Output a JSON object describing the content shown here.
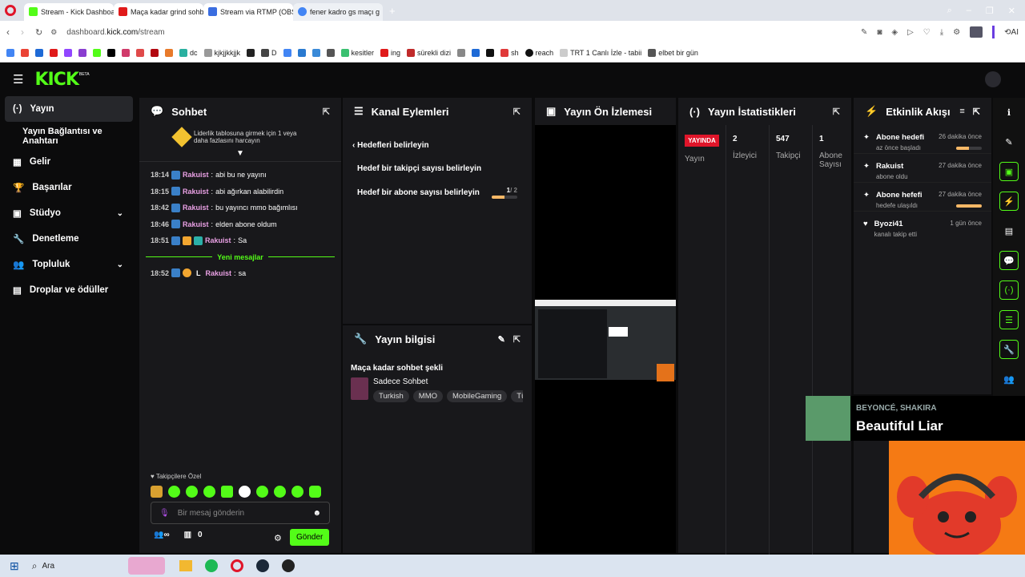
{
  "browser": {
    "tabs": [
      {
        "title": "Stream - Kick Dashboard",
        "color": "#53fc18",
        "active": true
      },
      {
        "title": "Maça kadar grind sohbet",
        "color": "#e01a1a",
        "active": true
      },
      {
        "title": "Stream via RTMP (OBS, Vm",
        "color": "#3a6de0",
        "active": true
      },
      {
        "title": "fener kadro gs maçı g",
        "color": "#4285f4",
        "active": false
      }
    ],
    "url_host": "dashboard.",
    "url_domain": "kick.com",
    "url_path": "/stream",
    "ai_label": "AI",
    "bookmarks": [
      "dc",
      "kjkjjkkjjk",
      "D",
      "kesitler",
      "ing",
      "sürekli dizi",
      "sh",
      "reach",
      "TRT 1 Canlı İzle - tabii",
      "elbet bir gün"
    ]
  },
  "brand": {
    "logo": "KICK",
    "beta": "BETA"
  },
  "sidebar": {
    "items": [
      {
        "label": "Yayın",
        "icon": "broadcast-icon",
        "glyph": "(·)",
        "active": true,
        "chevron": false
      },
      {
        "label": "Yayın Bağlantısı ve Anahtarı",
        "icon": "",
        "glyph": "",
        "active": false,
        "chevron": false
      },
      {
        "label": "Gelir",
        "icon": "revenue-icon",
        "glyph": "▦",
        "active": false,
        "chevron": false
      },
      {
        "label": "Başarılar",
        "icon": "trophy-icon",
        "glyph": "🏆",
        "active": false,
        "chevron": false
      },
      {
        "label": "Stüdyo",
        "icon": "studio-icon",
        "glyph": "▣",
        "active": false,
        "chevron": true
      },
      {
        "label": "Denetleme",
        "icon": "wrench-icon",
        "glyph": "🔧",
        "active": false,
        "chevron": false
      },
      {
        "label": "Topluluk",
        "icon": "community-icon",
        "glyph": "👥",
        "active": false,
        "chevron": true
      },
      {
        "label": "Droplar ve ödüller",
        "icon": "gift-icon",
        "glyph": "▤",
        "active": false,
        "chevron": false
      }
    ]
  },
  "chat": {
    "title": "Sohbet",
    "leaderboard": "Liderlik tablosuna girmek için 1 veya daha fazlasını harcayın",
    "messages": [
      {
        "time": "18:14",
        "user": "Rakuist",
        "text": "abi bu ne yayını"
      },
      {
        "time": "18:15",
        "user": "Rakuist",
        "text": "abi ağırkan alabilirdin"
      },
      {
        "time": "18:42",
        "user": "Rakuist",
        "text": "bu yayıncı mmo bağımlısı"
      },
      {
        "time": "18:46",
        "user": "Rakuist",
        "text": "elden abone oldum"
      },
      {
        "time": "18:51",
        "user": "Rakuist",
        "text": "Sa"
      }
    ],
    "new_messages": "Yeni mesajlar",
    "new_msg": {
      "time": "18:52",
      "prefix": "L",
      "user": "Rakuist",
      "text": "sa"
    },
    "followers_only": "Takipçilere Özel",
    "input_placeholder": "Bir mesaj gönderin",
    "points": "0",
    "send": "Gönder"
  },
  "actions": {
    "title": "Kanal Eylemleri",
    "back": "Hedefleri belirleyin",
    "goal1": "Hedef bir takipçi sayısı belirleyin",
    "goal2": "Hedef bir abone sayısı belirleyin",
    "goal2_progress": "1",
    "goal2_total": "/ 2",
    "goal2_fraction": 0.5
  },
  "info": {
    "title": "Yayın bilgisi",
    "stream_title": "Maça kadar sohbet şekli",
    "category": "Sadece Sohbet",
    "tags": [
      "Turkish",
      "MMO",
      "MobileGaming",
      "Tür"
    ]
  },
  "preview": {
    "title": "Yayın Ön İzlemesi"
  },
  "stats": {
    "title": "Yayın İstatistikleri",
    "live": "YAYINDA",
    "live_label": "Yayın",
    "viewers": "2",
    "viewers_label": "İzleyici",
    "followers": "547",
    "followers_label": "Takipçi",
    "subs": "1",
    "subs_label": "Abone Sayısı"
  },
  "activity": {
    "title": "Etkinlik Akışı",
    "items": [
      {
        "name": "Abone hedefi",
        "time": "26 dakika önce",
        "sub": "az önce başladı",
        "progress": 0.5,
        "icon": "sparkle-icon",
        "glyph": "✦"
      },
      {
        "name": "Rakuist",
        "time": "27 dakika önce",
        "sub": "abone oldu",
        "progress": null,
        "icon": "sparkle-icon",
        "glyph": "✦"
      },
      {
        "name": "Abone hefefi",
        "time": "27 dakika önce",
        "sub": "hedefe ulaşıldı",
        "progress": 1.0,
        "icon": "sparkle-icon",
        "glyph": "✦"
      },
      {
        "name": "Byozi41",
        "time": "1 gün önce",
        "sub": "kanalı takip etti",
        "progress": null,
        "icon": "heart-icon",
        "glyph": "♥"
      }
    ]
  },
  "music": {
    "artist": "BEYONCÉ, SHAKIRA",
    "song": "Beautiful Liar"
  },
  "taskbar": {
    "search": "Ara"
  },
  "colors": {
    "accent": "#53fc18",
    "live": "#e0152a",
    "panel": "#18181b"
  }
}
